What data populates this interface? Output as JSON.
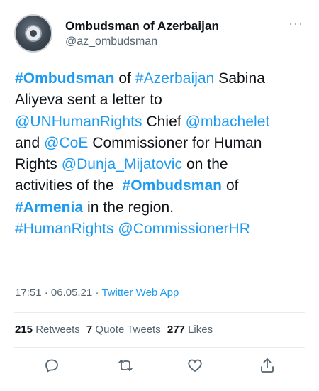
{
  "author": {
    "display_name": "Ombudsman of Azerbaijan",
    "handle": "@az_ombudsman"
  },
  "more_label": "···",
  "tweet": {
    "lines": [
      [
        {
          "text": "#Ombudsman",
          "kind": "link-bold"
        },
        {
          "text": " of ",
          "kind": "plain"
        },
        {
          "text": "#Azerbaijan",
          "kind": "link"
        },
        {
          "text": " Sabina",
          "kind": "plain"
        }
      ],
      [
        {
          "text": "Aliyeva sent a letter to",
          "kind": "plain"
        }
      ],
      [
        {
          "text": "@UNHumanRights",
          "kind": "link"
        },
        {
          "text": " Chief ",
          "kind": "plain"
        },
        {
          "text": "@mbachelet",
          "kind": "link"
        }
      ],
      [
        {
          "text": "and ",
          "kind": "plain"
        },
        {
          "text": "@CoE",
          "kind": "link"
        },
        {
          "text": " Commissioner for Human",
          "kind": "plain"
        }
      ],
      [
        {
          "text": "Rights ",
          "kind": "plain"
        },
        {
          "text": "@Dunja_Mijatovic",
          "kind": "link"
        },
        {
          "text": " on the",
          "kind": "plain"
        }
      ],
      [
        {
          "text": "activities of the  ",
          "kind": "plain"
        },
        {
          "text": "#Ombudsman",
          "kind": "link-bold"
        },
        {
          "text": " of",
          "kind": "plain"
        }
      ],
      [
        {
          "text": "#Armenia",
          "kind": "link-bold"
        },
        {
          "text": " in the region.",
          "kind": "plain"
        }
      ],
      [
        {
          "text": "#HumanRights",
          "kind": "link"
        },
        {
          "text": " ",
          "kind": "plain"
        },
        {
          "text": "@CommissionerHR",
          "kind": "link"
        }
      ]
    ]
  },
  "meta": {
    "time": "17:51",
    "separator": " · ",
    "date": "06.05.21",
    "app": "Twitter Web App"
  },
  "stats": {
    "retweets_count": "215",
    "retweets_label": "Retweets",
    "quotes_count": "7",
    "quotes_label": "Quote Tweets",
    "likes_count": "277",
    "likes_label": "Likes"
  },
  "actions": [
    {
      "name": "reply-icon"
    },
    {
      "name": "retweet-icon"
    },
    {
      "name": "like-icon"
    },
    {
      "name": "share-icon"
    }
  ],
  "colors": {
    "link": "#1d9bf0",
    "text": "#0f1419",
    "secondary": "#536471",
    "divider": "#e6ecf0"
  }
}
